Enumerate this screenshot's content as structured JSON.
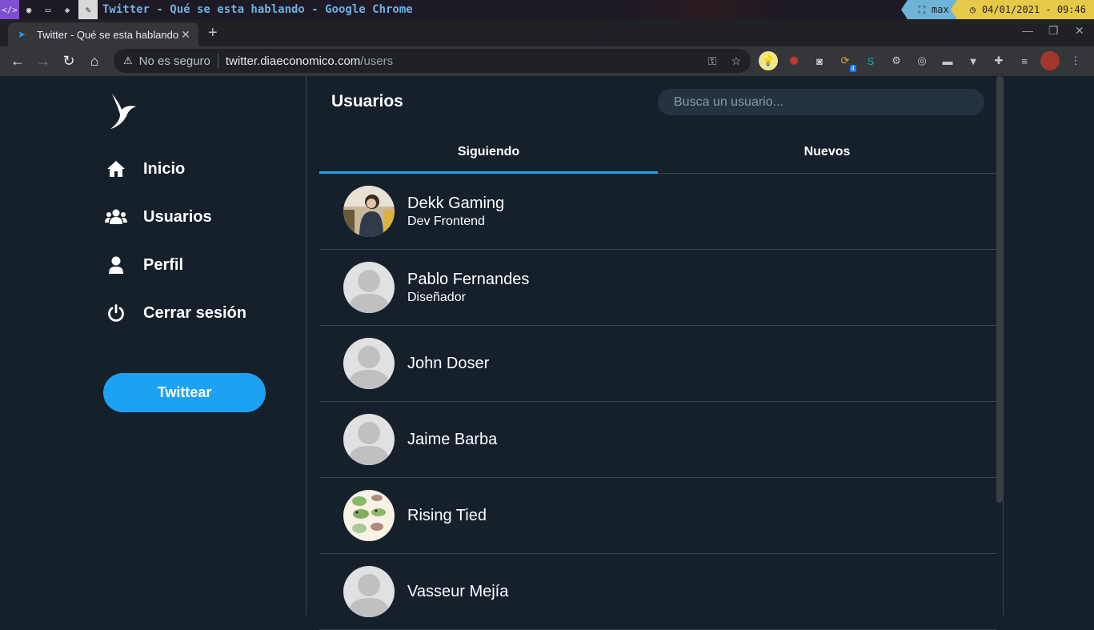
{
  "os_bar": {
    "window_title": "Twitter - Qué se esta hablando - Google Chrome",
    "layout_label": "max",
    "clock": "04/01/2021 - 09:46"
  },
  "browser": {
    "tab_title": "Twitter - Qué se esta hablando",
    "security_label": "No es seguro",
    "url_host": "twitter.diaeconomico.com",
    "url_path": "/users",
    "extension_badge": "4"
  },
  "sidebar": {
    "items": [
      {
        "label": "Inicio",
        "icon": "home-icon"
      },
      {
        "label": "Usuarios",
        "icon": "users-icon"
      },
      {
        "label": "Perfil",
        "icon": "user-icon"
      },
      {
        "label": "Cerrar sesión",
        "icon": "power-icon"
      }
    ],
    "tweet_button": "Twittear"
  },
  "main": {
    "title": "Usuarios",
    "search_placeholder": "Busca un usuario...",
    "tabs": [
      {
        "label": "Siguiendo",
        "active": true
      },
      {
        "label": "Nuevos",
        "active": false
      }
    ],
    "users": [
      {
        "name": "Dekk Gaming",
        "bio": "Dev Frontend",
        "avatar": "photo"
      },
      {
        "name": "Pablo Fernandes",
        "bio": "Diseñador",
        "avatar": "default"
      },
      {
        "name": "John Doser",
        "bio": "",
        "avatar": "default"
      },
      {
        "name": "Jaime Barba",
        "bio": "",
        "avatar": "default"
      },
      {
        "name": "Rising Tied",
        "bio": "",
        "avatar": "pattern"
      },
      {
        "name": "Vasseur Mejía",
        "bio": "",
        "avatar": "default"
      }
    ]
  },
  "colors": {
    "background": "#15202b",
    "accent": "#1da1f2",
    "border": "#38444d"
  }
}
